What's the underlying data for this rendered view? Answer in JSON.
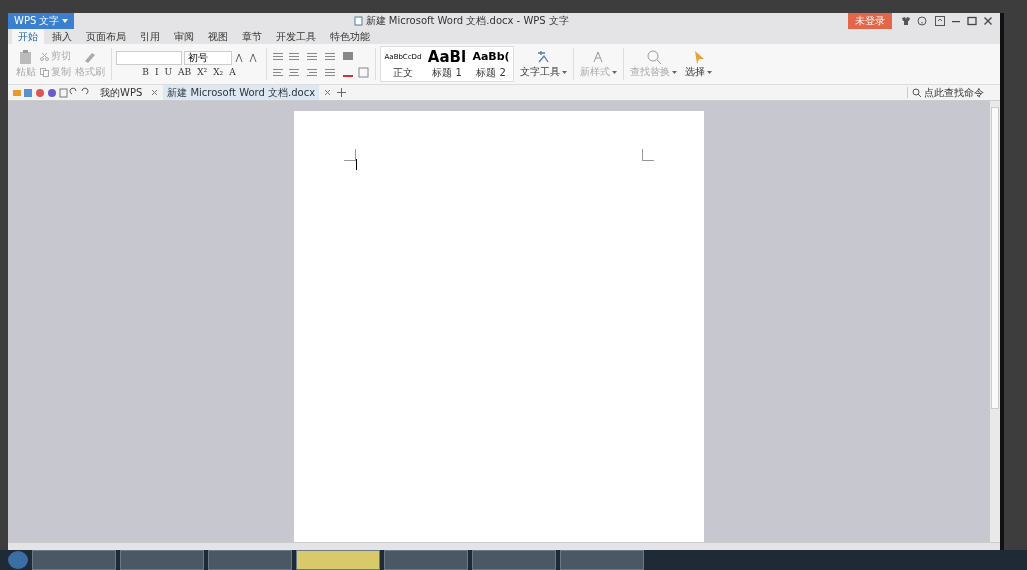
{
  "app_menu": {
    "label": "WPS 文字"
  },
  "window": {
    "title": "新建 Microsoft Word 文档.docx - WPS 文字"
  },
  "login_button": {
    "label": "未登录"
  },
  "ribbon_tabs": [
    {
      "label": "开始",
      "selected": true
    },
    {
      "label": "插入",
      "selected": false
    },
    {
      "label": "页面布局",
      "selected": false
    },
    {
      "label": "引用",
      "selected": false
    },
    {
      "label": "审阅",
      "selected": false
    },
    {
      "label": "视图",
      "selected": false
    },
    {
      "label": "章节",
      "selected": false
    },
    {
      "label": "开发工具",
      "selected": false
    },
    {
      "label": "特色功能",
      "selected": false
    }
  ],
  "clipboard": {
    "paste": {
      "label": "粘贴",
      "disabled": true
    },
    "cut": {
      "label": "剪切",
      "disabled": true
    },
    "copy": {
      "label": "复制",
      "disabled": true
    },
    "format_painter": {
      "label": "格式刷",
      "disabled": true
    }
  },
  "font": {
    "size": "初号",
    "format_buttons": [
      "B",
      "I",
      "U",
      "AB",
      "X²",
      "X₂",
      "A"
    ]
  },
  "styles": [
    {
      "preview": "AaBbCcDd",
      "label": "正文",
      "kind": "body"
    },
    {
      "preview": "AaBl",
      "label": "标题 1",
      "kind": "heading1"
    },
    {
      "preview": "AaBb(",
      "label": "标题 2",
      "kind": "heading2"
    }
  ],
  "tools": [
    {
      "label": "文字工具",
      "kind": "text",
      "disabled": false
    },
    {
      "label": "新样式",
      "kind": "style",
      "disabled": true
    },
    {
      "label": "查找替换",
      "kind": "find",
      "disabled": true
    },
    {
      "label": "选择",
      "kind": "select",
      "disabled": false
    }
  ],
  "doc_tabs": [
    {
      "label": "我的WPS",
      "selected": false
    },
    {
      "label": "新建 Microsoft Word 文档.docx",
      "selected": true
    }
  ],
  "command_search": {
    "placeholder": "点此查找命令"
  }
}
